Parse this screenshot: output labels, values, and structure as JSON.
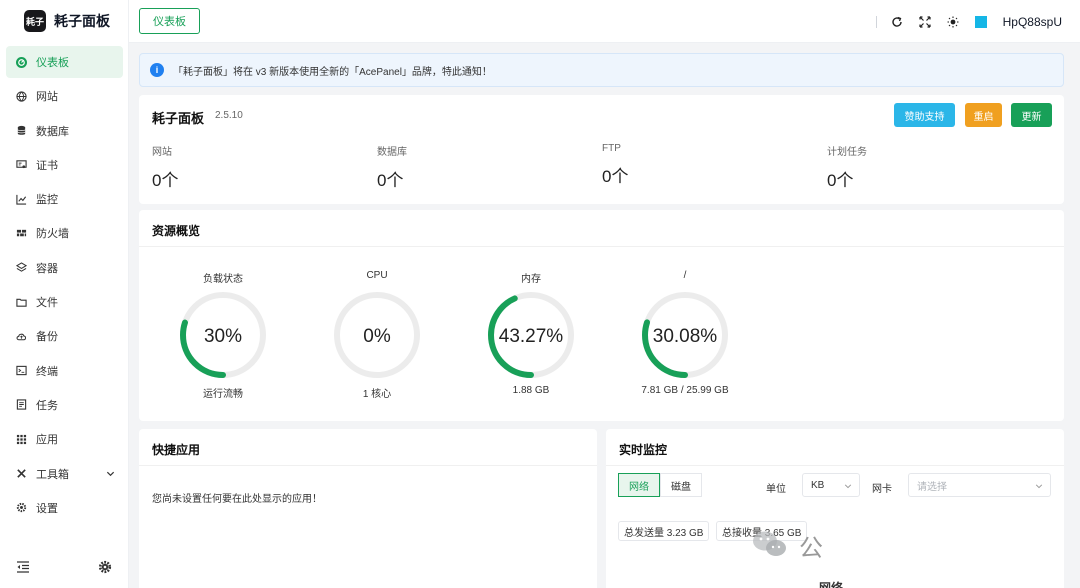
{
  "app": {
    "logo_text": "耗子",
    "name": "耗子面板"
  },
  "sidebar": {
    "items": [
      {
        "label": "仪表板",
        "icon": "dashboard-icon",
        "active": true
      },
      {
        "label": "网站",
        "icon": "globe-icon"
      },
      {
        "label": "数据库",
        "icon": "database-icon"
      },
      {
        "label": "证书",
        "icon": "certificate-icon"
      },
      {
        "label": "监控",
        "icon": "chart-line-icon"
      },
      {
        "label": "防火墙",
        "icon": "firewall-icon"
      },
      {
        "label": "容器",
        "icon": "layers-icon"
      },
      {
        "label": "文件",
        "icon": "folder-icon"
      },
      {
        "label": "备份",
        "icon": "cloud-backup-icon"
      },
      {
        "label": "终端",
        "icon": "terminal-icon"
      },
      {
        "label": "任务",
        "icon": "task-icon"
      },
      {
        "label": "应用",
        "icon": "apps-grid-icon"
      },
      {
        "label": "工具箱",
        "icon": "tools-icon"
      },
      {
        "label": "设置",
        "icon": "gear-icon"
      }
    ]
  },
  "header": {
    "tab": "仪表板",
    "hostname": "HpQ88spU",
    "accent_color": "#15b6e6"
  },
  "notice": {
    "text": "「耗子面板」将在 v3 新版本使用全新的「AcePanel」品牌，特此通知！"
  },
  "panel": {
    "title": "耗子面板",
    "version": "2.5.10",
    "buttons": {
      "sponsor": "赞助支持",
      "restart": "重启",
      "update": "更新"
    },
    "stats": [
      {
        "label": "网站",
        "value": "0个"
      },
      {
        "label": "数据库",
        "value": "0个"
      },
      {
        "label": "FTP",
        "value": "0个"
      },
      {
        "label": "计划任务",
        "value": "0个"
      }
    ]
  },
  "resources": {
    "title": "资源概览",
    "gauges": [
      {
        "label": "负载状态",
        "value": "30%",
        "percent": 30,
        "sub": "运行流畅"
      },
      {
        "label": "CPU",
        "value": "0%",
        "percent": 0,
        "sub": "1 核心"
      },
      {
        "label": "内存",
        "value": "43.27%",
        "percent": 43.27,
        "sub": "1.88 GB"
      },
      {
        "label": "/",
        "value": "30.08%",
        "percent": 30.08,
        "sub": "7.81 GB / 25.99 GB"
      }
    ]
  },
  "quick_apps": {
    "title": "快捷应用",
    "empty": "您尚未设置任何要在此处显示的应用！"
  },
  "monitor": {
    "title": "实时监控",
    "tabs": [
      "网络",
      "磁盘"
    ],
    "unit_label": "单位",
    "unit_value": "KB",
    "nic_label": "网卡",
    "nic_placeholder": "请选择",
    "sent": "总发送量 3.23 GB",
    "received": "总接收量 3.65 GB",
    "watermark": "公",
    "net_title": "网络"
  },
  "colors": {
    "primary": "#18a058",
    "info": "#2080f0",
    "warning": "#f0a020",
    "sponsor": "#2bb6e8"
  }
}
